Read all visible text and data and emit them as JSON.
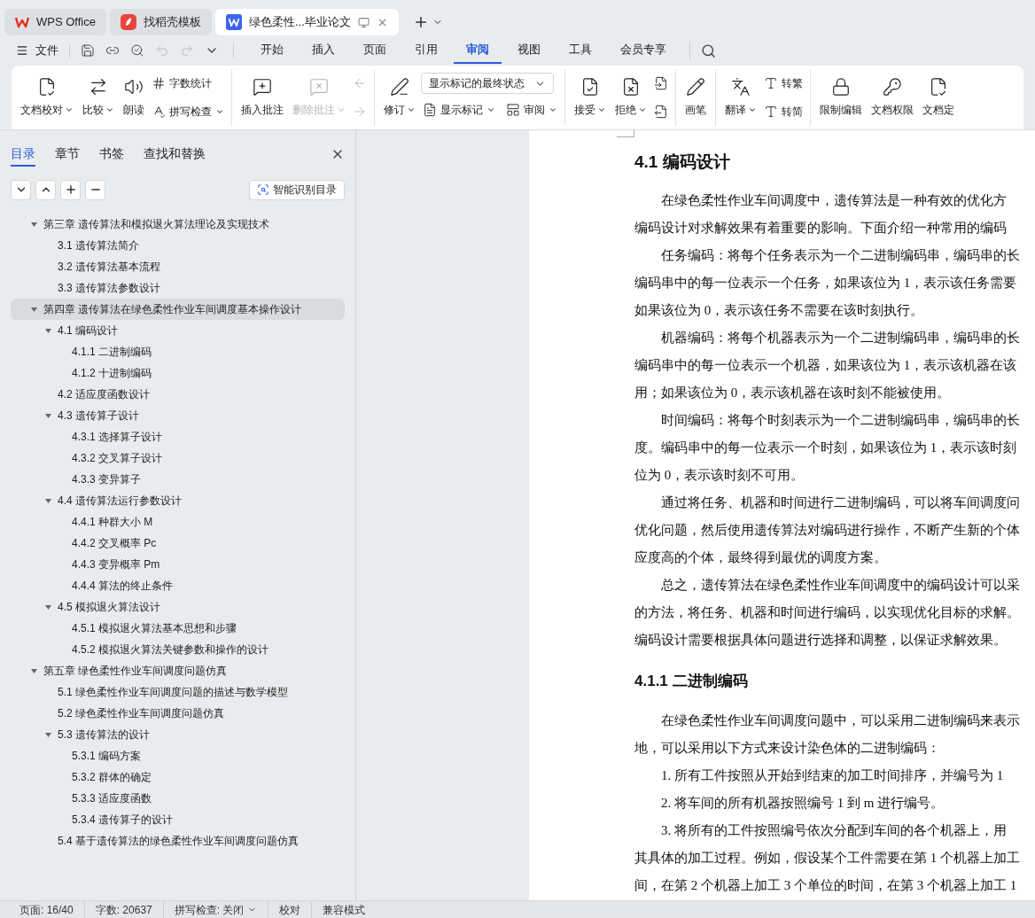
{
  "title_tabs": [
    {
      "label": "WPS Office",
      "kind": "home",
      "selected": false
    },
    {
      "label": "找稻壳模板",
      "kind": "template",
      "selected": false
    },
    {
      "label": "绿色柔性...毕业论文",
      "kind": "document",
      "selected": true
    }
  ],
  "menu": {
    "file": "文件",
    "tabs": [
      {
        "label": "开始",
        "selected": false
      },
      {
        "label": "插入",
        "selected": false
      },
      {
        "label": "页面",
        "selected": false
      },
      {
        "label": "引用",
        "selected": false
      },
      {
        "label": "审阅",
        "selected": true
      },
      {
        "label": "视图",
        "selected": false
      },
      {
        "label": "工具",
        "selected": false
      },
      {
        "label": "会员专享",
        "selected": false
      }
    ]
  },
  "ribbon": [
    {
      "columns": [
        {
          "kind": "big",
          "label": "文档校对",
          "dropdown": true,
          "disabled": false
        },
        {
          "kind": "big",
          "label": "比较",
          "dropdown": true,
          "disabled": false
        },
        {
          "kind": "big",
          "label": "朗读",
          "dropdown": false,
          "disabled": false
        },
        {
          "kind": "stack",
          "items": [
            {
              "label": "字数统计",
              "dropdown": false,
              "disabled": false
            },
            {
              "label": "拼写检查",
              "dropdown": true,
              "disabled": false
            }
          ]
        }
      ]
    },
    {
      "columns": [
        {
          "kind": "big",
          "label": "插入批注",
          "dropdown": false,
          "disabled": false
        },
        {
          "kind": "big",
          "label": "删除批注",
          "dropdown": true,
          "disabled": true
        },
        {
          "kind": "stack",
          "items": [
            {
              "dropdown": false,
              "disabled": true
            },
            {
              "dropdown": false,
              "disabled": true
            }
          ]
        }
      ]
    },
    {
      "columns": [
        {
          "kind": "big",
          "label": "修订",
          "dropdown": true,
          "disabled": false
        },
        {
          "kind": "select_stack",
          "select": "显示标记的最终状态",
          "items": [
            {
              "label": "显示标记",
              "dropdown": true,
              "disabled": false
            },
            {
              "label": "审阅",
              "dropdown": true,
              "disabled": false
            }
          ]
        }
      ]
    },
    {
      "columns": [
        {
          "kind": "big",
          "label": "接受",
          "dropdown": true,
          "disabled": false
        },
        {
          "kind": "big",
          "label": "拒绝",
          "dropdown": true,
          "disabled": false
        },
        {
          "kind": "stack",
          "items": [
            {
              "dropdown": false,
              "disabled": false
            },
            {
              "dropdown": false,
              "disabled": false
            }
          ]
        }
      ]
    },
    {
      "columns": [
        {
          "kind": "big",
          "label": "画笔",
          "dropdown": false,
          "disabled": false
        }
      ]
    },
    {
      "columns": [
        {
          "kind": "big",
          "label": "翻译",
          "dropdown": true,
          "disabled": false
        },
        {
          "kind": "stack",
          "items": [
            {
              "label": "转繁",
              "dropdown": false,
              "disabled": false
            },
            {
              "label": "转简",
              "dropdown": false,
              "disabled": false
            }
          ]
        }
      ]
    },
    {
      "columns": [
        {
          "kind": "big",
          "label": "限制编辑",
          "dropdown": false,
          "disabled": false
        },
        {
          "kind": "big",
          "label": "文档权限",
          "dropdown": false,
          "disabled": false
        },
        {
          "kind": "big",
          "label": "文档定",
          "dropdown": false,
          "disabled": false
        }
      ]
    }
  ],
  "sidebar": {
    "tabs": [
      {
        "label": "目录",
        "selected": true
      },
      {
        "label": "章节",
        "selected": false
      },
      {
        "label": "书签",
        "selected": false
      },
      {
        "label": "查找和替换",
        "selected": false
      }
    ],
    "smart_button": "智能识别目录",
    "toc": [
      {
        "label": "第三章  遗传算法和模拟退火算法理论及实现技术",
        "expanded": true,
        "selected": false,
        "children": [
          {
            "label": "3.1  遗传算法简介",
            "selected": false
          },
          {
            "label": "3.2  遗传算法基本流程",
            "selected": false
          },
          {
            "label": "3.3  遗传算法参数设计",
            "selected": false
          }
        ]
      },
      {
        "label": "第四章  遗传算法在绿色柔性作业车间调度基本操作设计",
        "expanded": true,
        "selected": true,
        "children": [
          {
            "label": "4.1  编码设计",
            "expanded": true,
            "selected": false,
            "children": [
              {
                "label": "4.1.1 二进制编码",
                "selected": false
              },
              {
                "label": "4.1.2 十进制编码",
                "selected": false
              }
            ]
          },
          {
            "label": "4.2 适应度函数设计",
            "selected": false
          },
          {
            "label": "4.3 遗传算子设计",
            "expanded": true,
            "selected": false,
            "children": [
              {
                "label": "4.3.1 选择算子设计",
                "selected": false
              },
              {
                "label": "4.3.2  交叉算子设计",
                "selected": false
              },
              {
                "label": "4.3.3 变异算子",
                "selected": false
              }
            ]
          },
          {
            "label": "4.4 遗传算法运行参数设计",
            "expanded": true,
            "selected": false,
            "children": [
              {
                "label": "4.4.1 种群大小 M",
                "selected": false
              },
              {
                "label": "4.4.2 交叉概率 Pc",
                "selected": false
              },
              {
                "label": "4.4.3 变异概率 Pm",
                "selected": false
              },
              {
                "label": "4.4.4 算法的终止条件",
                "selected": false
              }
            ]
          },
          {
            "label": "4.5 模拟退火算法设计",
            "expanded": true,
            "selected": false,
            "children": [
              {
                "label": "4.5.1 模拟退火算法基本思想和步骤",
                "selected": false
              },
              {
                "label": "4.5.2 模拟退火算法关键参数和操作的设计",
                "selected": false
              }
            ]
          }
        ]
      },
      {
        "label": "第五章  绿色柔性作业车间调度问题仿真",
        "expanded": true,
        "selected": false,
        "children": [
          {
            "label": "5.1  绿色柔性作业车间调度问题的描述与数学模型",
            "selected": false
          },
          {
            "label": "5.2  绿色柔性作业车间调度问题仿真",
            "selected": false
          },
          {
            "label": "5.3  遗传算法的设计",
            "expanded": true,
            "selected": false,
            "children": [
              {
                "label": "5.3.1  编码方案",
                "selected": false
              },
              {
                "label": "5.3.2  群体的确定",
                "selected": false
              },
              {
                "label": "5.3.3  适应度函数",
                "selected": false
              },
              {
                "label": "5.3.4  遗传算子的设计",
                "selected": false
              }
            ]
          },
          {
            "label": "5.4  基于遗传算法的绿色柔性作业车间调度问题仿真",
            "selected": false
          }
        ]
      }
    ]
  },
  "document": [
    {
      "kind": "heading",
      "text": "4.1  编码设计"
    },
    {
      "kind": "line",
      "indent": true,
      "text": "在绿色柔性作业车间调度中，遗传算法是一种有效的优化方"
    },
    {
      "kind": "line",
      "indent": false,
      "text": "编码设计对求解效果有着重要的影响。下面介绍一种常用的编码"
    },
    {
      "kind": "line",
      "indent": true,
      "text": "任务编码：将每个任务表示为一个二进制编码串，编码串的长"
    },
    {
      "kind": "line",
      "indent": false,
      "text": "编码串中的每一位表示一个任务，如果该位为 1，表示该任务需要"
    },
    {
      "kind": "line",
      "indent": false,
      "text": "如果该位为 0，表示该任务不需要在该时刻执行。"
    },
    {
      "kind": "line",
      "indent": true,
      "text": "机器编码：将每个机器表示为一个二进制编码串，编码串的长"
    },
    {
      "kind": "line",
      "indent": false,
      "text": "编码串中的每一位表示一个机器，如果该位为 1，表示该机器在该"
    },
    {
      "kind": "line",
      "indent": false,
      "text": "用；如果该位为 0，表示该机器在该时刻不能被使用。"
    },
    {
      "kind": "line",
      "indent": true,
      "text": "时间编码：将每个时刻表示为一个二进制编码串，编码串的长"
    },
    {
      "kind": "line",
      "indent": false,
      "text": "度。编码串中的每一位表示一个时刻，如果该位为 1，表示该时刻"
    },
    {
      "kind": "line",
      "indent": false,
      "text": "位为 0，表示该时刻不可用。"
    },
    {
      "kind": "line",
      "indent": true,
      "text": "通过将任务、机器和时间进行二进制编码，可以将车间调度问"
    },
    {
      "kind": "line",
      "indent": false,
      "text": "优化问题，然后使用遗传算法对编码进行操作，不断产生新的个体"
    },
    {
      "kind": "line",
      "indent": false,
      "text": "应度高的个体，最终得到最优的调度方案。"
    },
    {
      "kind": "line",
      "indent": true,
      "text": "总之，遗传算法在绿色柔性作业车间调度中的编码设计可以采"
    },
    {
      "kind": "line",
      "indent": false,
      "text": "的方法，将任务、机器和时间进行编码，以实现优化目标的求解。"
    },
    {
      "kind": "line",
      "indent": false,
      "text": "编码设计需要根据具体问题进行选择和调整，以保证求解效果。"
    },
    {
      "kind": "subheading",
      "text": "4.1.1 二进制编码"
    },
    {
      "kind": "line",
      "indent": true,
      "text": "在绿色柔性作业车间调度问题中，可以采用二进制编码来表示"
    },
    {
      "kind": "line",
      "indent": false,
      "text": "地，可以采用以下方式来设计染色体的二进制编码："
    },
    {
      "kind": "line",
      "indent": true,
      "text": "1.  所有工件按照从开始到结束的加工时间排序，并编号为 1"
    },
    {
      "kind": "line",
      "indent": true,
      "text": "2.  将车间的所有机器按照编号 1 到 m 进行编号。"
    },
    {
      "kind": "line",
      "indent": true,
      "text": "3.  将所有的工件按照编号依次分配到车间的各个机器上，用"
    },
    {
      "kind": "line",
      "indent": false,
      "text": "其具体的加工过程。例如，假设某个工件需要在第 1 个机器上加工"
    },
    {
      "kind": "line",
      "indent": false,
      "text": "间，在第 2 个机器上加工 3 个单位的时间，在第 3 个机器上加工 1"
    }
  ],
  "status_bar": [
    {
      "text": "页面: 16/40",
      "dropdown": false
    },
    {
      "text": "字数: 20637",
      "dropdown": false
    },
    {
      "text": "拼写检查: 关闭",
      "dropdown": true
    },
    {
      "text": "校对",
      "dropdown": false
    },
    {
      "text": "兼容模式",
      "dropdown": false
    }
  ]
}
